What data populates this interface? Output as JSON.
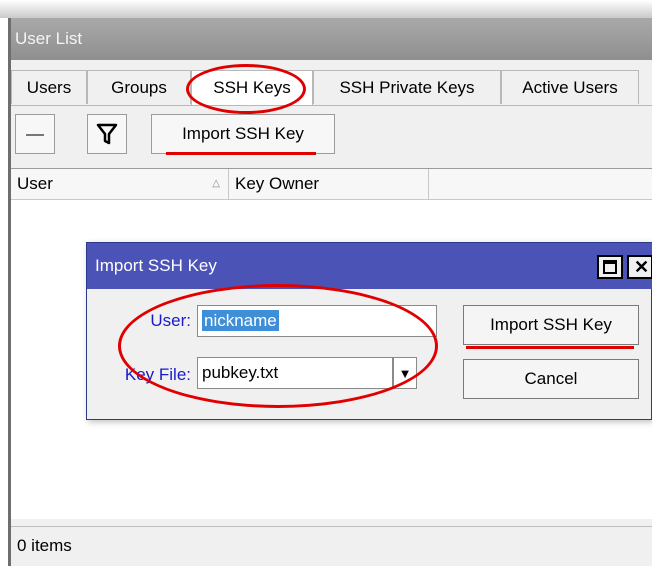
{
  "window": {
    "title": "User List"
  },
  "tabs": [
    {
      "label": "Users"
    },
    {
      "label": "Groups"
    },
    {
      "label": "SSH Keys"
    },
    {
      "label": "SSH Private Keys"
    },
    {
      "label": "Active Users"
    }
  ],
  "toolbar": {
    "remove_icon": "minus-icon",
    "filter_icon": "filter-icon",
    "import_label": "Import SSH Key"
  },
  "grid": {
    "columns": [
      {
        "label": "User"
      },
      {
        "label": "Key Owner"
      }
    ],
    "rows": []
  },
  "status": {
    "text": "0 items"
  },
  "dialog": {
    "title": "Import SSH Key",
    "user_label": "User:",
    "user_value": "nickname",
    "keyfile_label": "Key File:",
    "keyfile_value": "pubkey.txt",
    "import_button": "Import SSH Key",
    "cancel_button": "Cancel"
  },
  "colors": {
    "dialog_title_bg": "#4c53b6",
    "annotation_red": "#e00000",
    "field_label_blue": "#1a1ac8",
    "selection_blue": "#3f8fd8"
  }
}
